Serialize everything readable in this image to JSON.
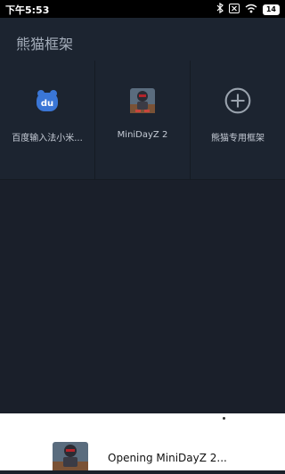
{
  "status": {
    "time": "下午5:53",
    "battery": "14",
    "icons": [
      "bluetooth-icon",
      "sim-blocked-icon",
      "wifi-icon",
      "battery-icon"
    ]
  },
  "header": {
    "title": "熊猫框架"
  },
  "apps": [
    {
      "label": "百度输入法小米...",
      "icon": "baidu-input-icon"
    },
    {
      "label": "MiniDayZ 2",
      "icon": "minidayz-icon"
    },
    {
      "label": "熊猫专用框架",
      "icon": "add-circle-icon"
    }
  ],
  "sheet": {
    "text": "Opening MiniDayZ 2...",
    "icon": "minidayz-icon"
  },
  "colors": {
    "background": "#1a202a",
    "header": "#1c2430",
    "sheet": "#ffffff",
    "baidu_blue": "#3a76d6"
  }
}
